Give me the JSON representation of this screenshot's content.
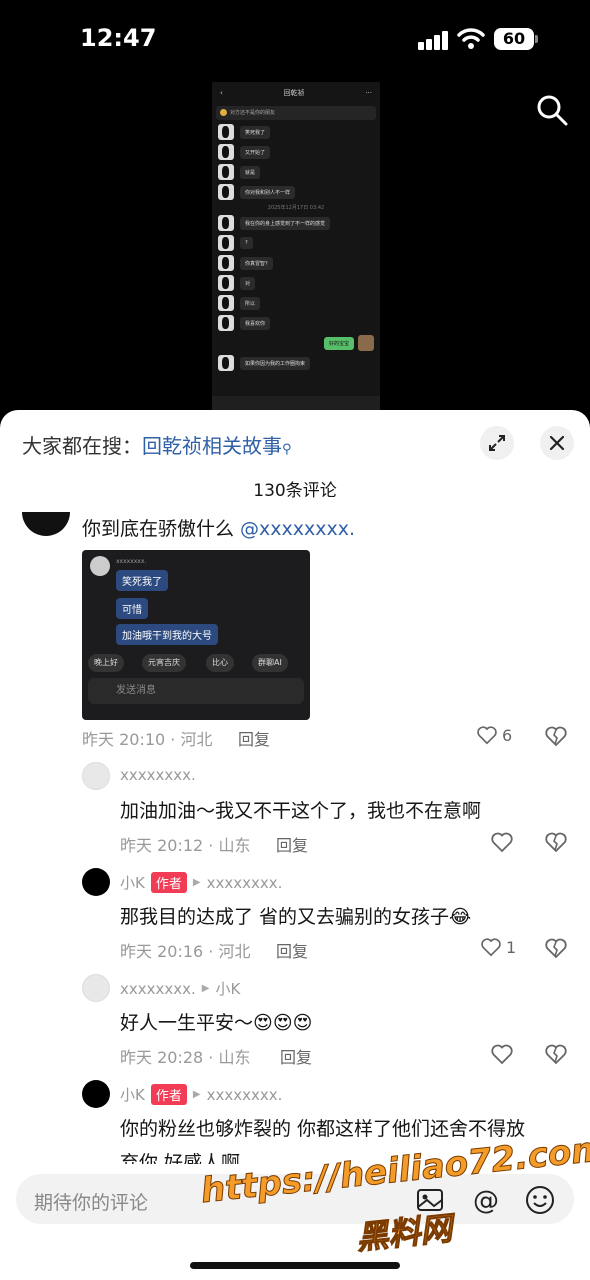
{
  "status_bar": {
    "time": "12:47",
    "battery": "60"
  },
  "video": {
    "chat_title": "回乾祯",
    "banner": "对方还不是你的朋友",
    "timestamp": "2025年12月17日 03:42",
    "messages": [
      {
        "text": "笑死我了",
        "from": "them"
      },
      {
        "text": "又开始了",
        "from": "them"
      },
      {
        "text": "就是",
        "from": "them"
      },
      {
        "text": "你对我和别人不一样",
        "from": "them"
      },
      {
        "text": "我在你的身上感觉到了不一样的感觉",
        "from": "them"
      },
      {
        "text": "?",
        "from": "them"
      },
      {
        "text": "你真冒智?",
        "from": "them"
      },
      {
        "text": "对",
        "from": "them"
      },
      {
        "text": "所以",
        "from": "them"
      },
      {
        "text": "我喜欢你",
        "from": "them"
      },
      {
        "text": "好的宝宝",
        "from": "me"
      },
      {
        "text": "如果你因为我的工作圈拘束",
        "from": "them"
      }
    ]
  },
  "sheet": {
    "search_prefix": "大家都在搜：",
    "search_term": "回乾祯相关故事",
    "comment_count": "130条评论",
    "input_placeholder": "期待你的评论",
    "reply_label": "回复"
  },
  "comments": [
    {
      "text_main": "你到底在骄傲什么 ",
      "mention": "@xxxxxxxx.",
      "meta": "昨天 20:10 · 河北",
      "likes": "6",
      "shot": {
        "name": "xxxxxxxx.",
        "bubbles": [
          "笑死我了",
          "可惜",
          "加油哦干到我的大号"
        ],
        "chips": [
          "晚上好",
          "元宵吉庆",
          "比心",
          "群聊AI"
        ],
        "input": "发送消息"
      }
    },
    {
      "user": "xxxxxxxx.",
      "text": "加油加油～我又不干这个了，我也不在意啊",
      "meta": "昨天 20:12 · 山东"
    },
    {
      "user": "小K",
      "tag": "作者",
      "target": "xxxxxxxx.",
      "text": "那我目的达成了 省的又去骗别的女孩子",
      "emoji": "😂",
      "meta": "昨天 20:16 · 河北",
      "likes": "1"
    },
    {
      "user": "xxxxxxxx.",
      "target": "小K",
      "text": "好人一生平安～",
      "emoji": "😍😍😍",
      "meta": "昨天 20:28 · 山东"
    },
    {
      "user": "小K",
      "tag": "作者",
      "target": "xxxxxxxx.",
      "line1": "你的粉丝也够炸裂的 你都这样了他们还舍不得放",
      "line2": "弃你 好感人啊"
    }
  ],
  "watermark": {
    "url": "https://heiliao72.com",
    "cn": "黑料网"
  },
  "colors": {
    "accent_blue": "#3060a8",
    "author_tag": "#f23b54",
    "watermark": "#f39c2a"
  }
}
